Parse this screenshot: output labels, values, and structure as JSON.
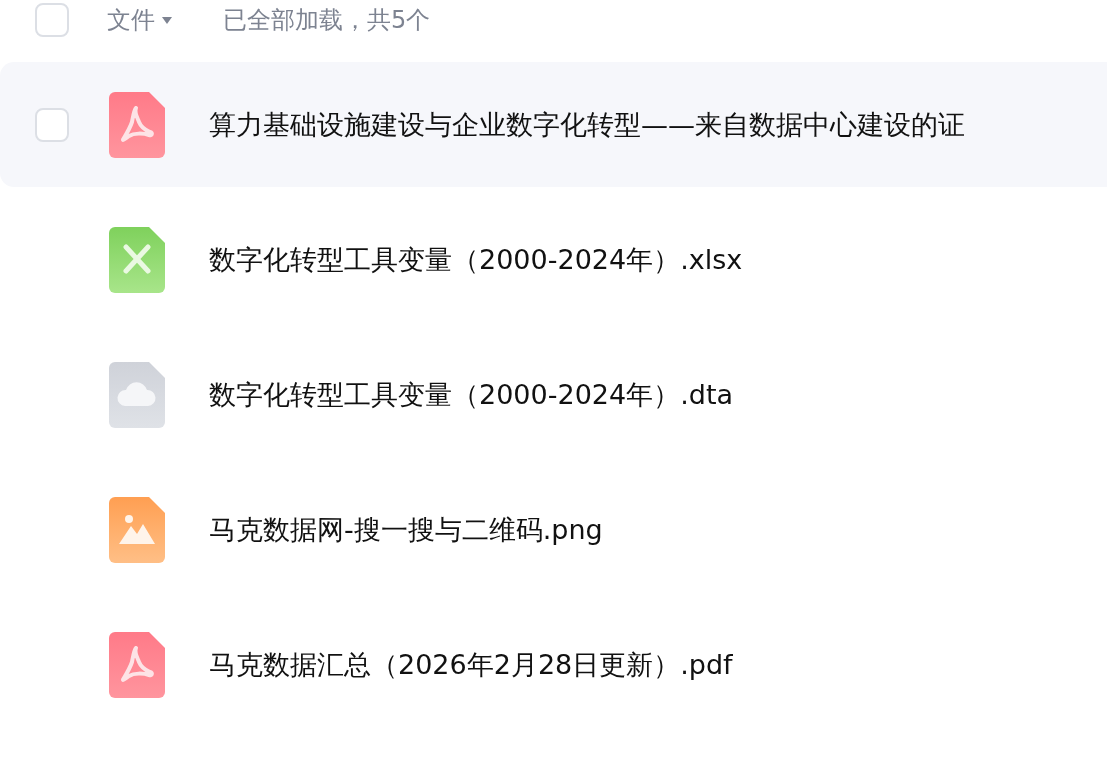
{
  "header": {
    "all_checked": false,
    "column_label": "文件",
    "status": "已全部加载，共5个"
  },
  "files": [
    {
      "name": "算力基础设施建设与企业数字化转型——来自数据中心建设的证",
      "kind": "pdf",
      "hovered": true,
      "checked": false
    },
    {
      "name": "数字化转型工具变量（2000-2024年）.xlsx",
      "kind": "sheet",
      "hovered": false
    },
    {
      "name": "数字化转型工具变量（2000-2024年）.dta",
      "kind": "cloud",
      "hovered": false
    },
    {
      "name": "马克数据网-搜一搜与二维码.png",
      "kind": "image",
      "hovered": false
    },
    {
      "name": "马克数据汇总（2026年2月28日更新）.pdf",
      "kind": "pdf",
      "hovered": false
    }
  ]
}
